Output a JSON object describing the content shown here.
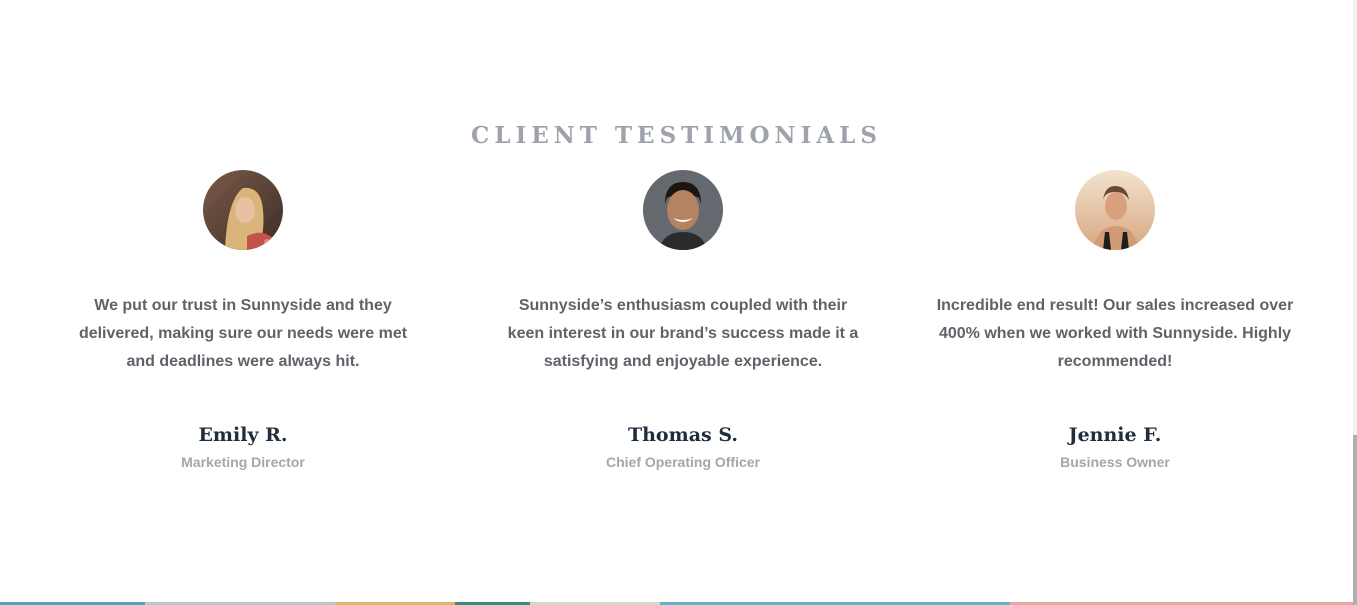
{
  "section": {
    "title": "CLIENT TESTIMONIALS"
  },
  "testimonials": [
    {
      "quote": "We put our trust in Sunnyside and they delivered, making sure our needs were met and deadlines were always hit.",
      "name": "Emily R.",
      "role": "Marketing Director"
    },
    {
      "quote": "Sunnyside’s enthusiasm coupled with their keen interest in our brand’s success made it a satisfying and enjoyable experience.",
      "name": "Thomas S.",
      "role": "Chief Operating Officer"
    },
    {
      "quote": "Incredible end result! Our sales increased over 400% when we worked with Sunnyside. Highly recommended!",
      "name": "Jennie F.",
      "role": "Business Owner"
    }
  ],
  "colors": {
    "title": "#9ea3ab",
    "quote": "#5f6369",
    "name": "#1f2d3d",
    "role": "#a3a7ad",
    "strip": [
      "#4aa3c8",
      "#b8c9c9",
      "#e5b26a",
      "#3e8b85",
      "#d9d5cc",
      "#5fb6c8",
      "#e8a6a0"
    ]
  }
}
